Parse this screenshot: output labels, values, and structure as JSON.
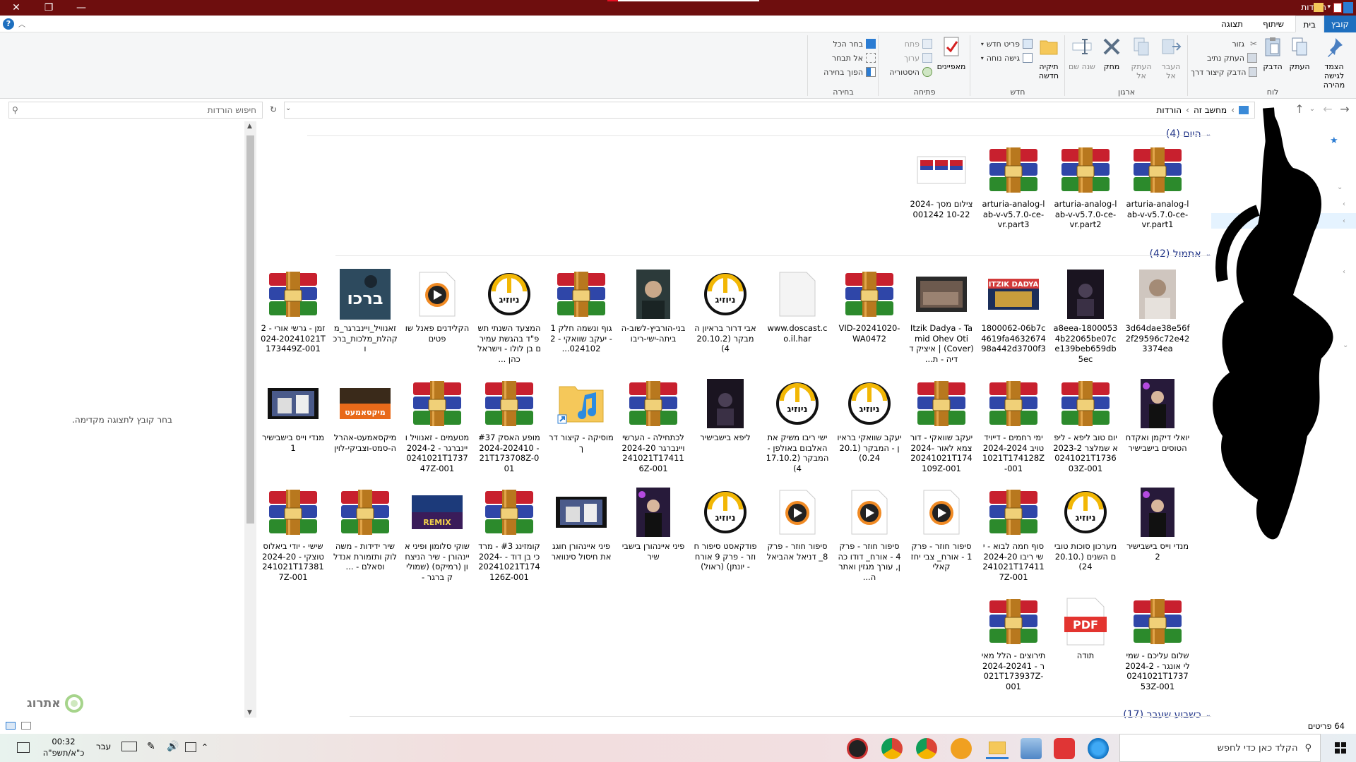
{
  "window": {
    "title": "הורדות"
  },
  "tabs": [
    "קובץ",
    "בית",
    "שיתוף",
    "תצוגה"
  ],
  "ribbon": {
    "pin_label": "הצמד לגישה מהירה",
    "copy_label": "העתק",
    "paste_label": "הדבק",
    "cut_label": "גזור",
    "copy_path_label": "העתק נתיב",
    "paste_shortcut_label": "הדבק קיצור דרך",
    "move_to_label": "העבר אל",
    "copy_to_label": "העתק אל",
    "delete_label": "מחק",
    "rename_label": "שנה שם",
    "new_folder_label": "תיקיה חדשה",
    "new_item_label": "פריט חדש",
    "easy_access_label": "גישה נוחה",
    "properties_label": "מאפיינים",
    "open_label": "פתח",
    "edit_label": "ערוך",
    "history_label": "היסטוריה",
    "select_all_label": "בחר הכל",
    "select_none_label": "אל תבחר",
    "invert_selection_label": "הפוך בחירה",
    "groups": {
      "clipboard": "לוח",
      "organize": "ארגון",
      "new": "חדש",
      "open": "פתיחה",
      "select": "בחירה"
    }
  },
  "address": {
    "crumbs": [
      "מחשב זה",
      "הורדות"
    ],
    "search_placeholder": "חיפוש הורדות"
  },
  "preview": {
    "message": "בחר קובץ לתצוגה מקדימה."
  },
  "groups": {
    "today": {
      "label": "היום (4)"
    },
    "earlier_month": {
      "label": "אתמול (42)"
    },
    "last_week": {
      "label": "כשבוע שעבר (17)"
    }
  },
  "files_today": [
    {
      "name": "arturia-analog-lab-v-v5.7.0-ce-vr.part1",
      "icon": "rar"
    },
    {
      "name": "arturia-analog-lab-v-v5.7.0-ce-vr.part2",
      "icon": "rar"
    },
    {
      "name": "arturia-analog-lab-v-v5.7.0-ce-vr.part3",
      "icon": "rar"
    },
    {
      "name": "צילום מסך 2024-10-22 001242",
      "icon": "screenshot"
    }
  ],
  "files_yesterday": [
    {
      "name": "3d64dae38e56f2f29596c72e423374ea",
      "icon": "photo-person"
    },
    {
      "name": "1800053-a8eea4b22065be07ce139beb659db5ec",
      "icon": "photo-dark"
    },
    {
      "name": "1800062-06b7c4619fa463267498a442d3700f3",
      "icon": "photo-concert"
    },
    {
      "name": "Itzik Dadya - Tamid Ohev Oti (Cover) | איציק דדיה - ת...",
      "icon": "video"
    },
    {
      "name": "VID-20241020-WA0472",
      "icon": "rar"
    },
    {
      "name": "www.doscast.co.il.har",
      "icon": "blank"
    },
    {
      "name": "אבי דרור בראיון המבקר (20.10.24)",
      "icon": "audio-logo"
    },
    {
      "name": "בני-הורביץ-לשוב-הביתה-ישי-ריבו",
      "icon": "photo-man"
    },
    {
      "name": "גוף ונשמה חלק 1 - יעקב שוואקי - 2024102...",
      "icon": "rar"
    },
    {
      "name": "המצעד השנתי תשפ\"ד בהגשת עמירם בן לולו - וישראל כהן ...",
      "icon": "audio-logo"
    },
    {
      "name": "הקלידנים פאנל שופטים",
      "icon": "play"
    },
    {
      "name": "זאנוויל_ויינברגר_מקהלת_מלכות_ברכו",
      "icon": "album"
    },
    {
      "name": "זמן - גרשי אורי - 2024-20241021T173449Z-001",
      "icon": "rar"
    },
    {
      "name": "יואלי דיקמן ואקדח הטוסים בישבישיר",
      "icon": "photo-stage"
    },
    {
      "name": "יום טוב ליפא - ליפא שמלצר 2023-20241021T173603Z-001",
      "icon": "rar"
    },
    {
      "name": "ימי רחמים - דייויד טויב 2024-20241021T174128Z-001",
      "icon": "rar"
    },
    {
      "name": "יעקב שוואקי - דור צמא לאור 2024-20241021T174109Z-001",
      "icon": "rar"
    },
    {
      "name": "יעקב שוואקי בראיון - המבקר (20.10.24)",
      "icon": "audio-logo"
    },
    {
      "name": "ישי ריבו משיק את האלבום באולפן - המבקר (17.10.24)",
      "icon": "audio-logo"
    },
    {
      "name": "ליפא בישבישיר",
      "icon": "photo-dark"
    },
    {
      "name": "לכתחילה - הערשי ויינברגר 2024-20241021T174116Z-001",
      "icon": "rar"
    },
    {
      "name": "מוסיקה - קיצור דרך",
      "icon": "music-folder"
    },
    {
      "name": "מופע האסק #37 - 2024-20241021T173708Z-001",
      "icon": "rar"
    },
    {
      "name": "מטעמים - זאנוויל ויינברגר - 2024-20241021T173747Z-001",
      "icon": "rar"
    },
    {
      "name": "מיקסאמעט-אהרלה-סמט-וצביקי-לוין",
      "icon": "album2"
    },
    {
      "name": "מנדי וייס בישבישיר 1",
      "icon": "video-wide"
    },
    {
      "name": "מנדי וייס בישבישיר 2",
      "icon": "photo-stage"
    },
    {
      "name": "מערכון סוכות טובים השנים (20.10.24)",
      "icon": "audio-logo"
    },
    {
      "name": "סוף חמה לבוא - ישי ריבו 2024-20241021T174117Z-001",
      "icon": "rar"
    },
    {
      "name": "סיפור חוזר - פרק 1 - אורח_ צבי יחזקאלי",
      "icon": "play"
    },
    {
      "name": "סיפור חוזר - פרק 4 - אורח_ דודו כהן, עורך מגזין ואתר ה...",
      "icon": "play"
    },
    {
      "name": "סיפור חוזר - פרק 8_ דניאל אהביאל",
      "icon": "play"
    },
    {
      "name": "פודקאסט סיפור חוזר - פרק 9 אורח - יונתן) (ראול)",
      "icon": "audio-logo"
    },
    {
      "name": "פיני איינהורן בישבישיר",
      "icon": "photo-stage"
    },
    {
      "name": "פיני איינהורן חוגג את חיסול סינוואר",
      "icon": "video-wide"
    },
    {
      "name": "קומזינג #3 - מרדכי בן דוד - 2024-20241021T174126Z-001",
      "icon": "rar"
    },
    {
      "name": "שוקי סלומון ופיני איינהורן - שיר הניצחון (רמיקס) (שמוליק ברגר -",
      "icon": "remix"
    },
    {
      "name": "שיר ידידות - משה לוק ותזמורת אנדלוסאלם - ...",
      "icon": "rar"
    },
    {
      "name": "שישי - יודי ביאלוסטוצקי - 2024-20241021T173817Z-001",
      "icon": "rar"
    },
    {
      "name": "שלום עליכם - שמילי אונגר - 2024-20241021T173753Z-001",
      "icon": "rar"
    },
    {
      "name": "תודה",
      "icon": "pdf"
    },
    {
      "name": "תירוצים - הלל מאיר - 2024-20241021T173937Z-001",
      "icon": "rar"
    }
  ],
  "status": {
    "count": "64 פריטים"
  },
  "taskbar": {
    "search_placeholder": "הקלד כאן כדי לחפש",
    "time": "00:32",
    "date": "כ\"א/תשפ\"ה",
    "lang": "עבר"
  },
  "brand": {
    "watermark": "אתרוג"
  },
  "colors": {
    "titlebar": "#6e0e0e",
    "file_tab": "#1e6fbf",
    "group_header": "#1e3287"
  }
}
